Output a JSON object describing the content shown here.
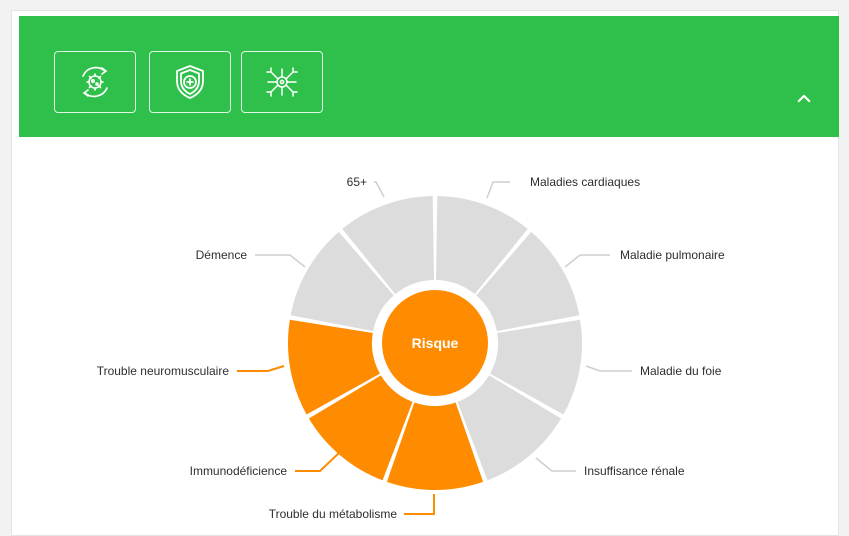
{
  "header": {
    "background": "#2fc04b",
    "buttons": [
      {
        "icon": "virus-cycle-icon"
      },
      {
        "icon": "shield-plus-icon"
      },
      {
        "icon": "neuron-icon"
      }
    ],
    "collapse_icon": "chevron-up-icon"
  },
  "wheel": {
    "center_label": "Risque",
    "active_color": "#ff8c00",
    "inactive_color": "#dcdcdc",
    "line_inactive_color": "#cfcfcf",
    "segments": [
      {
        "label": "Maladies cardiaques",
        "active": false
      },
      {
        "label": "Maladie pulmonaire",
        "active": false
      },
      {
        "label": "Maladie du foie",
        "active": false
      },
      {
        "label": "Insuffisance rénale",
        "active": false
      },
      {
        "label": "Trouble du métabolisme",
        "active": true
      },
      {
        "label": "Immunodéficience",
        "active": true
      },
      {
        "label": "Trouble neuromusculaire",
        "active": true
      },
      {
        "label": "Démence",
        "active": false
      },
      {
        "label": "65+",
        "active": false
      }
    ]
  }
}
